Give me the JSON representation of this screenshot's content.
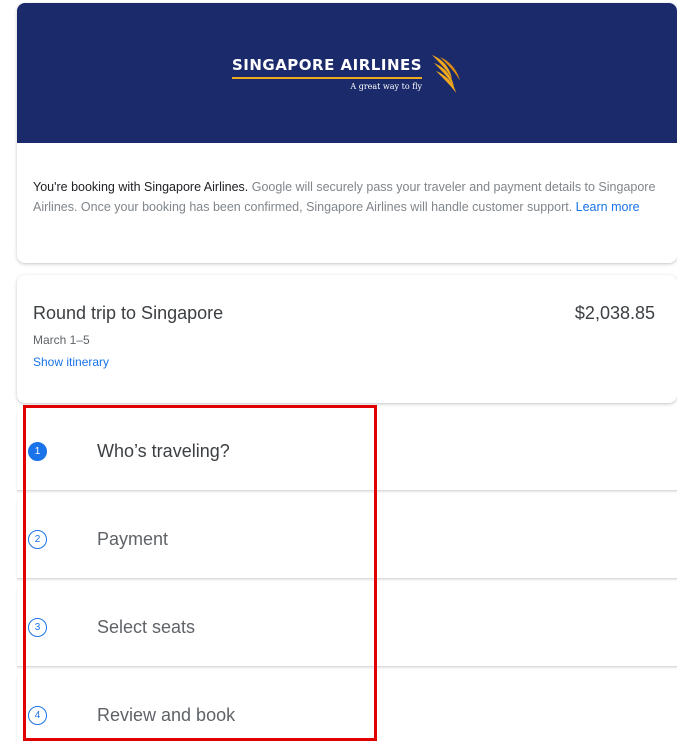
{
  "header": {
    "airline_name": "SINGAPORE AIRLINES",
    "tagline": "A great way to fly",
    "logo_icon": "singapore-airlines-bird-logo",
    "banner_color": "#1b2a6b",
    "logo_accent_color": "#f0a81c"
  },
  "booking_info": {
    "lead": "You're booking with Singapore Airlines.",
    "body": " Google will securely pass your traveler and payment details to Singapore Airlines. Once your booking has been confirmed, Singapore Airlines will handle customer support. ",
    "learn_more": "Learn more"
  },
  "trip": {
    "title": "Round trip to Singapore",
    "price": "$2,038.85",
    "dates": "March 1–5",
    "show_itinerary": "Show itinerary"
  },
  "steps": [
    {
      "number": "1",
      "label": "Who’s traveling?",
      "active": true
    },
    {
      "number": "2",
      "label": "Payment",
      "active": false
    },
    {
      "number": "3",
      "label": "Select seats",
      "active": false
    },
    {
      "number": "4",
      "label": "Review and book",
      "active": false
    }
  ],
  "colors": {
    "accent": "#1a73e8",
    "highlight_box": "#e00000"
  }
}
